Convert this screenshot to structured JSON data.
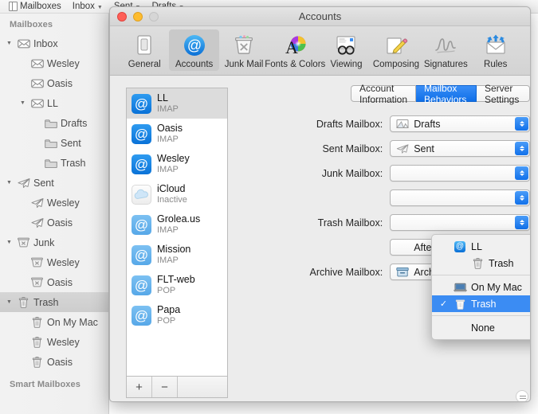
{
  "menubar": {
    "items": [
      {
        "label": "Mailboxes",
        "icon": "sidebar-toggle-icon",
        "caret": false
      },
      {
        "label": "Inbox",
        "icon": "",
        "caret": true
      },
      {
        "label": "Sent",
        "icon": "",
        "caret": true
      },
      {
        "label": "Drafts",
        "icon": "",
        "caret": true
      }
    ]
  },
  "sidebar": {
    "section_title": "Mailboxes",
    "footer_title": "Smart Mailboxes",
    "rows": [
      {
        "label": "Inbox",
        "icon": "inbox-envelope-icon",
        "indent": 0,
        "twisty": "down",
        "selected": false
      },
      {
        "label": "Wesley",
        "icon": "inbox-envelope-icon",
        "indent": 1,
        "twisty": "",
        "selected": false
      },
      {
        "label": "Oasis",
        "icon": "inbox-envelope-icon",
        "indent": 1,
        "twisty": "",
        "selected": false
      },
      {
        "label": "LL",
        "icon": "inbox-envelope-icon",
        "indent": 1,
        "twisty": "down",
        "selected": false
      },
      {
        "label": "Drafts",
        "icon": "folder-icon",
        "indent": 2,
        "twisty": "",
        "selected": false
      },
      {
        "label": "Sent",
        "icon": "folder-icon",
        "indent": 2,
        "twisty": "",
        "selected": false
      },
      {
        "label": "Trash",
        "icon": "folder-icon",
        "indent": 2,
        "twisty": "",
        "selected": false
      },
      {
        "label": "Sent",
        "icon": "paper-plane-icon",
        "indent": 0,
        "twisty": "down",
        "selected": false
      },
      {
        "label": "Wesley",
        "icon": "paper-plane-icon",
        "indent": 1,
        "twisty": "",
        "selected": false
      },
      {
        "label": "Oasis",
        "icon": "paper-plane-icon",
        "indent": 1,
        "twisty": "",
        "selected": false
      },
      {
        "label": "Junk",
        "icon": "junk-bin-icon",
        "indent": 0,
        "twisty": "down",
        "selected": false
      },
      {
        "label": "Wesley",
        "icon": "junk-bin-icon",
        "indent": 1,
        "twisty": "",
        "selected": false
      },
      {
        "label": "Oasis",
        "icon": "junk-bin-icon",
        "indent": 1,
        "twisty": "",
        "selected": false
      },
      {
        "label": "Trash",
        "icon": "trash-can-icon",
        "indent": 0,
        "twisty": "down",
        "selected": true
      },
      {
        "label": "On My Mac",
        "icon": "trash-can-icon",
        "indent": 1,
        "twisty": "",
        "selected": false
      },
      {
        "label": "Wesley",
        "icon": "trash-can-icon",
        "indent": 1,
        "twisty": "",
        "selected": false
      },
      {
        "label": "Oasis",
        "icon": "trash-can-icon",
        "indent": 1,
        "twisty": "",
        "selected": false
      }
    ]
  },
  "window": {
    "title": "Accounts",
    "traffic": {
      "close": "close-button",
      "minimize": "minimize-button",
      "zoom": "zoom-button"
    }
  },
  "toolbar": {
    "items": [
      {
        "label": "General",
        "icon": "general-icon",
        "active": false
      },
      {
        "label": "Accounts",
        "icon": "accounts-at-icon",
        "active": true
      },
      {
        "label": "Junk Mail",
        "icon": "junk-mail-icon",
        "active": false
      },
      {
        "label": "Fonts & Colors",
        "icon": "fonts-colors-icon",
        "active": false
      },
      {
        "label": "Viewing",
        "icon": "viewing-icon",
        "active": false
      },
      {
        "label": "Composing",
        "icon": "composing-icon",
        "active": false
      },
      {
        "label": "Signatures",
        "icon": "signatures-icon",
        "active": false
      },
      {
        "label": "Rules",
        "icon": "rules-icon",
        "active": false
      }
    ]
  },
  "accounts_list": {
    "add_label": "+",
    "remove_label": "−",
    "items": [
      {
        "name": "LL",
        "type": "IMAP",
        "icon": "at-account-icon",
        "style": "imap",
        "selected": true
      },
      {
        "name": "Oasis",
        "type": "IMAP",
        "icon": "at-account-icon",
        "style": "imap",
        "selected": false
      },
      {
        "name": "Wesley",
        "type": "IMAP",
        "icon": "at-account-icon",
        "style": "imap",
        "selected": false
      },
      {
        "name": "iCloud",
        "type": "Inactive",
        "icon": "icloud-cloud-icon",
        "style": "cloud",
        "selected": false
      },
      {
        "name": "Grolea.us",
        "type": "IMAP",
        "icon": "at-account-icon",
        "style": "dim",
        "selected": false
      },
      {
        "name": "Mission",
        "type": "IMAP",
        "icon": "at-account-icon",
        "style": "dim",
        "selected": false
      },
      {
        "name": "FLT-web",
        "type": "POP",
        "icon": "at-account-icon",
        "style": "dim",
        "selected": false
      },
      {
        "name": "Papa",
        "type": "POP",
        "icon": "at-account-icon",
        "style": "dim",
        "selected": false
      }
    ]
  },
  "tabs": [
    {
      "label": "Account Information",
      "active": false
    },
    {
      "label": "Mailbox Behaviors",
      "active": true
    },
    {
      "label": "Server Settings",
      "active": false
    }
  ],
  "form": {
    "rows": [
      {
        "label": "Drafts Mailbox:",
        "value": "Drafts",
        "icon": "drafts-icon",
        "hidden": false
      },
      {
        "label": "Sent Mailbox:",
        "value": "Sent",
        "icon": "sent-plane-icon",
        "hidden": false
      },
      {
        "label": "Junk Mailbox:",
        "value": "",
        "icon": "",
        "hidden": true
      },
      {
        "label": "",
        "value": "",
        "icon": "",
        "hidden": true
      },
      {
        "label": "Trash Mailbox:",
        "value": "",
        "icon": "",
        "hidden": true
      },
      {
        "label": "",
        "value": "After one month",
        "icon": "",
        "hidden": true
      },
      {
        "label": "Archive Mailbox:",
        "value": "Archive",
        "icon": "archive-icon",
        "hidden": false
      }
    ]
  },
  "dropdown_menu": {
    "items": [
      {
        "label": "LL",
        "icon": "at-account-icon",
        "level": 0,
        "checked": false,
        "highlighted": false,
        "separator_after": false
      },
      {
        "label": "Trash",
        "icon": "trash-can-icon",
        "level": 1,
        "checked": false,
        "highlighted": false,
        "separator_after": true
      },
      {
        "label": "On My Mac",
        "icon": "laptop-icon",
        "level": 0,
        "checked": false,
        "highlighted": false,
        "separator_after": false
      },
      {
        "label": "Trash",
        "icon": "trash-can-icon",
        "level": 0,
        "checked": true,
        "highlighted": true,
        "separator_after": true
      },
      {
        "label": "None",
        "icon": "",
        "level": 0,
        "checked": false,
        "highlighted": false,
        "separator_after": false
      }
    ]
  },
  "colors": {
    "accent_blue": "#1271ea",
    "highlight_blue": "#3b8cf3",
    "window_bg": "#ececec",
    "sidebar_bg": "#f0f0f0"
  }
}
